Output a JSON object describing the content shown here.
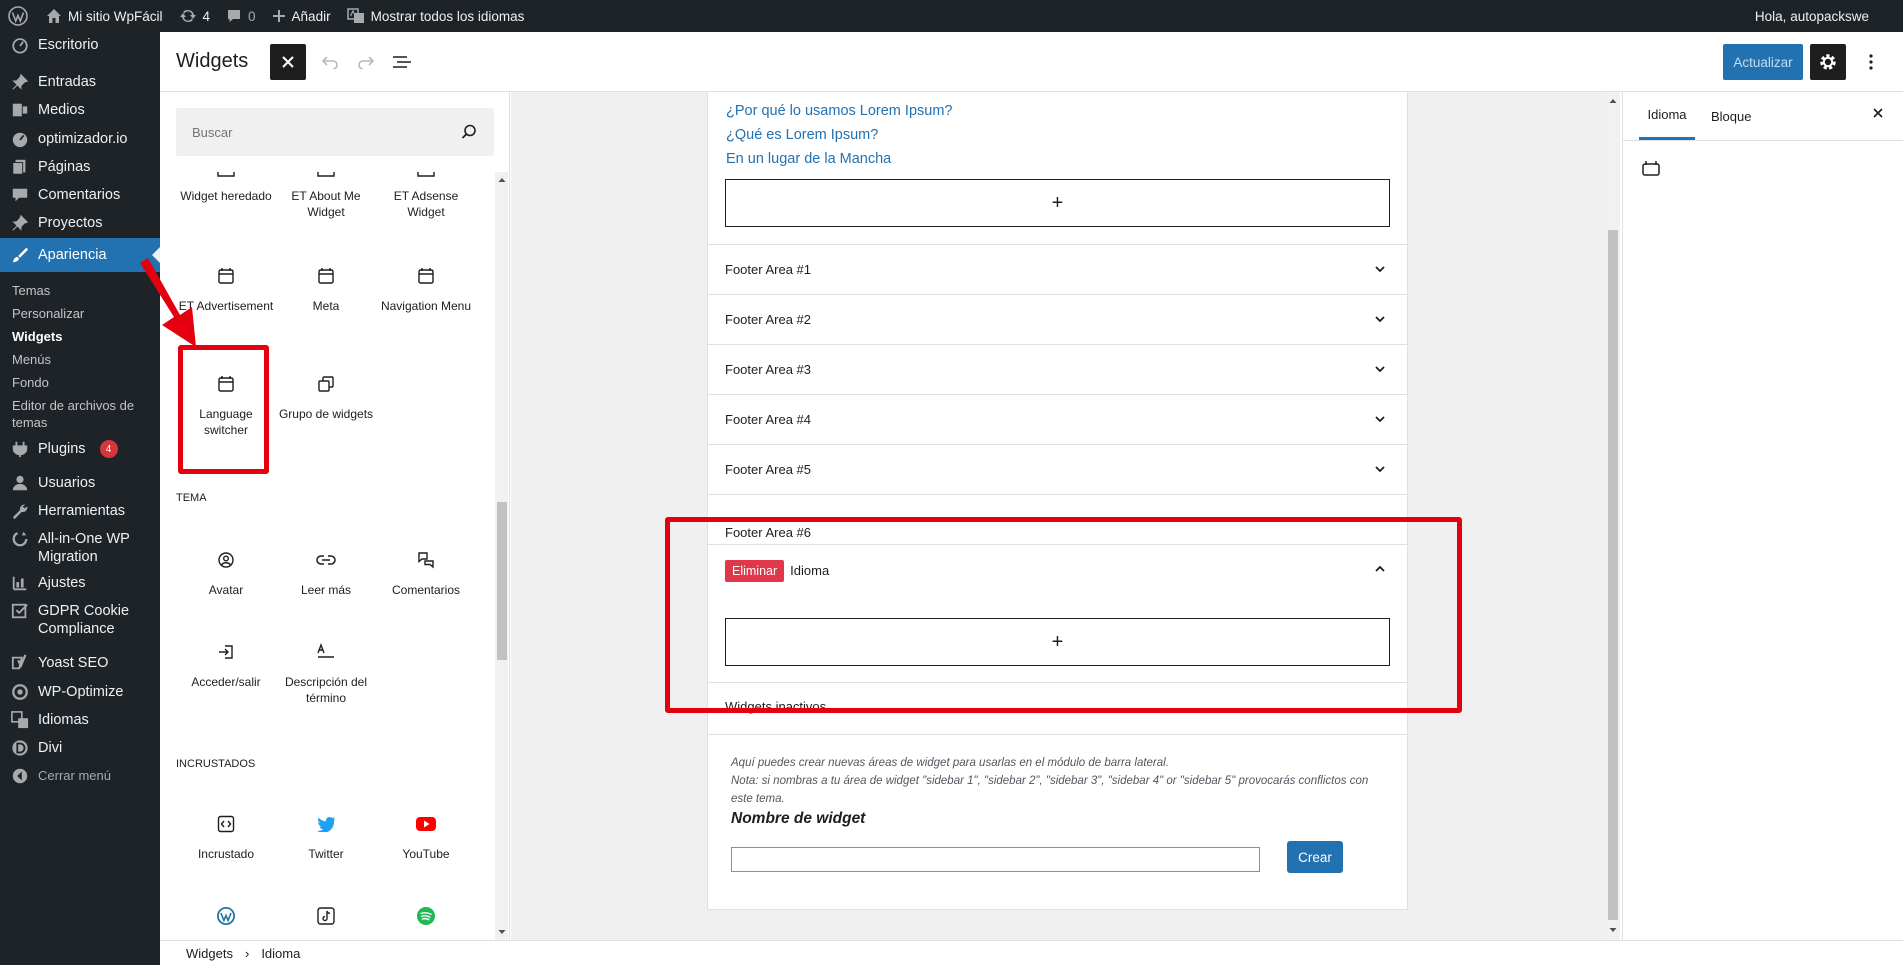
{
  "admin_bar": {
    "site_name": "Mi sitio WpFácil",
    "updates_count": "4",
    "comments_count": "0",
    "add_label": "Añadir",
    "languages_label": "Mostrar todos los idiomas",
    "greeting": "Hola, autopackswe"
  },
  "sidebar": {
    "items": [
      {
        "label": "Escritorio",
        "icon": "dashboard-icon"
      },
      {
        "label": "Entradas",
        "icon": "pin-icon"
      },
      {
        "label": "Medios",
        "icon": "media-icon"
      },
      {
        "label": "optimizador.io",
        "icon": "speedometer-icon"
      },
      {
        "label": "Páginas",
        "icon": "pages-icon"
      },
      {
        "label": "Comentarios",
        "icon": "comment-icon"
      },
      {
        "label": "Proyectos",
        "icon": "pin-icon"
      },
      {
        "label": "Apariencia",
        "icon": "brush-icon"
      },
      {
        "label": "Plugins",
        "icon": "plugin-icon",
        "badge": "4"
      },
      {
        "label": "Usuarios",
        "icon": "user-icon"
      },
      {
        "label": "Herramientas",
        "icon": "wrench-icon"
      },
      {
        "label": "All-in-One WP Migration",
        "icon": "migration-icon"
      },
      {
        "label": "Ajustes",
        "icon": "settings-icon"
      },
      {
        "label": "GDPR Cookie Compliance",
        "icon": "checkbox-icon"
      },
      {
        "label": "Yoast SEO",
        "icon": "yoast-icon"
      },
      {
        "label": "WP-Optimize",
        "icon": "optimize-icon"
      },
      {
        "label": "Idiomas",
        "icon": "translate-icon"
      },
      {
        "label": "Divi",
        "icon": "divi-icon"
      },
      {
        "label": "Cerrar menú",
        "icon": "collapse-icon"
      }
    ],
    "submenu": [
      {
        "label": "Temas"
      },
      {
        "label": "Personalizar"
      },
      {
        "label": "Widgets"
      },
      {
        "label": "Menús"
      },
      {
        "label": "Fondo"
      },
      {
        "label": "Editor de archivos de temas"
      }
    ]
  },
  "header": {
    "title": "Widgets",
    "update_label": "Actualizar"
  },
  "inserter": {
    "search_placeholder": "Buscar",
    "blocks_top": [
      {
        "label": "Widget heredado"
      },
      {
        "label": "ET About Me Widget"
      },
      {
        "label": "ET Adsense Widget"
      },
      {
        "label": "ET Advertisement"
      },
      {
        "label": "Meta"
      },
      {
        "label": "Navigation Menu"
      },
      {
        "label": "Language switcher"
      },
      {
        "label": "Grupo de widgets"
      }
    ],
    "cat_tema": "TEMA",
    "blocks_tema": [
      {
        "label": "Avatar"
      },
      {
        "label": "Leer más"
      },
      {
        "label": "Comentarios"
      },
      {
        "label": "Acceder/salir"
      },
      {
        "label": "Descripción del término"
      }
    ],
    "cat_incrustados": "INCRUSTADOS",
    "blocks_embed": [
      {
        "label": "Incrustado"
      },
      {
        "label": "Twitter"
      },
      {
        "label": "YouTube"
      }
    ]
  },
  "canvas": {
    "links": [
      "¿Por qué lo usamos Lorem Ipsum?",
      "¿Qué es Lorem Ipsum?",
      "En un lugar de la Mancha"
    ],
    "appender_symbol": "+",
    "areas": [
      "Footer Area #1",
      "Footer Area #2",
      "Footer Area #3",
      "Footer Area #4",
      "Footer Area #5",
      "Footer Area #6"
    ],
    "eliminar_label": "Eliminar",
    "idioma_label": "Idioma",
    "inactive_label": "Widgets inactivos",
    "help_line1": "Aquí puedes crear nuevas áreas de widget para usarlas en el módulo de barra lateral.",
    "help_line2": "Nota: si nombras a tu área de widget \"sidebar 1\", \"sidebar 2\", \"sidebar 3\", \"sidebar 4\" or \"sidebar 5\" provocarás conflictos con este tema.",
    "nombre_label": "Nombre de widget",
    "nombre_value": "",
    "crear_label": "Crear"
  },
  "settings_panel": {
    "tab_idioma": "Idioma",
    "tab_bloque": "Bloque"
  },
  "footer": {
    "crumb_1": "Widgets",
    "separator": "›",
    "crumb_2": "Idioma"
  },
  "colors": {
    "admin_bg": "#1d2327",
    "accent": "#2271b1",
    "annotation_red": "#e4000f",
    "delete_red": "#e0384a"
  }
}
